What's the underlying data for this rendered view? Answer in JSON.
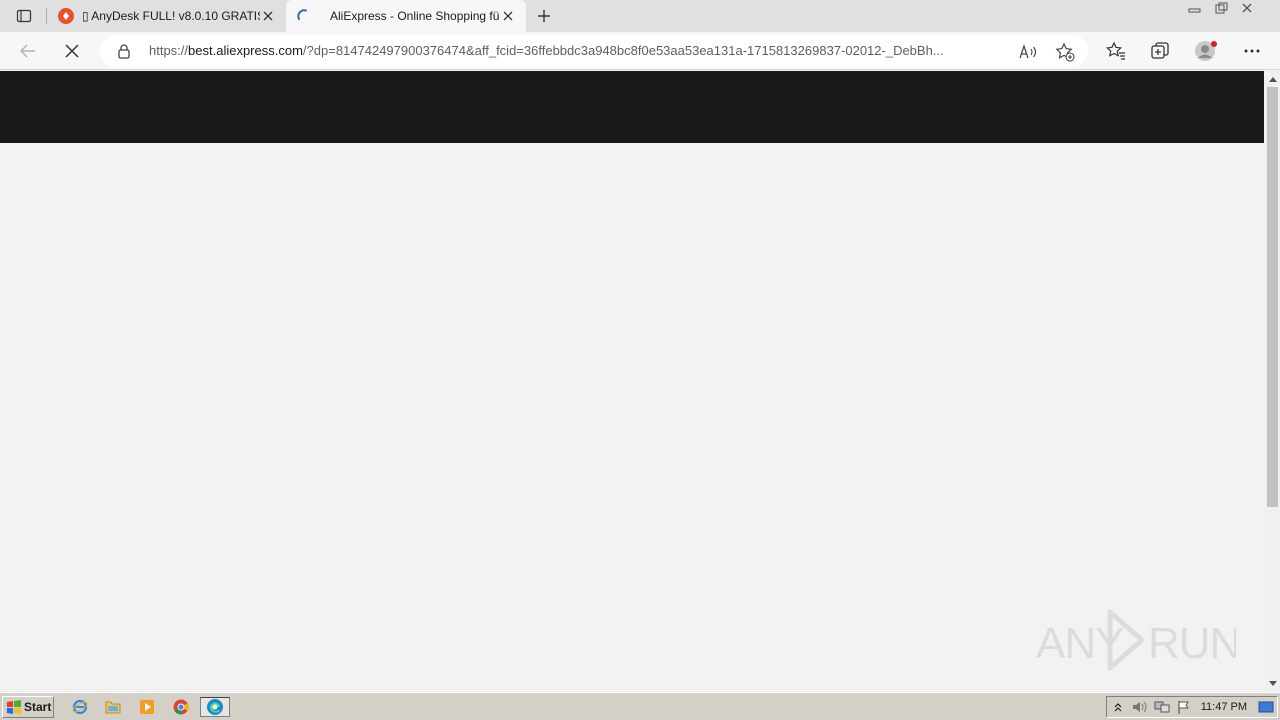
{
  "tabs": [
    {
      "title": "▯ AnyDesk FULL! v8.0.10 GRATIS!",
      "icon": "anydesk-favicon-icon",
      "active": false
    },
    {
      "title": "AliExpress - Online Shopping für",
      "icon": "loading-spinner-icon",
      "active": true
    }
  ],
  "address": {
    "scheme": "https://",
    "host": "best.aliexpress.com",
    "rest": "/?dp=814742497900376474&aff_fcid=36ffebbdc3a948bc8f0e53aa53ea131a-1715813269837-02012-_DebBh..."
  },
  "taskbar": {
    "start_label": "Start",
    "clock": "11:47 PM"
  },
  "watermark": {
    "text": "ANY RUN"
  },
  "colors": {
    "page_header": "#191919",
    "page_bg": "#f2f2f2",
    "tabbar_bg": "#e0e0e0",
    "taskbar_bg": "#d4d0c8"
  }
}
